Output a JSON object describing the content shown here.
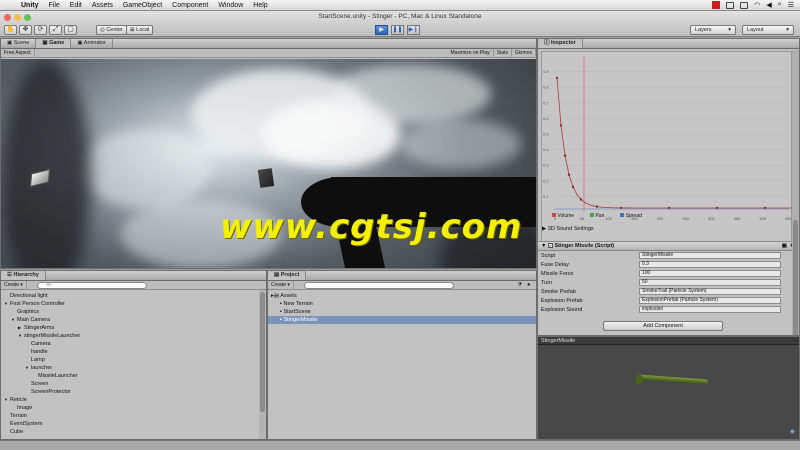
{
  "menubar": {
    "apple": "",
    "items": [
      "Unity",
      "File",
      "Edit",
      "Assets",
      "GameObject",
      "Component",
      "Window",
      "Help"
    ]
  },
  "window": {
    "title": "StartScene.unity - Stinger - PC, Mac & Linux Standalone"
  },
  "toolbar": {
    "pivot_label": "Center",
    "space_label": "Local",
    "layers_label": "Layers",
    "layout_label": "Layout"
  },
  "scene_tabs": [
    "Scene",
    "Game",
    "Animator"
  ],
  "game_bar": {
    "aspect": "Free Aspect",
    "maximize": "Maximize on Play",
    "stats": "Stats",
    "gizmos": "Gizmos"
  },
  "hierarchy": {
    "title": "Hierarchy",
    "create": "Create",
    "search_placeholder": "All",
    "items": [
      {
        "label": "Directional light",
        "indent": 0,
        "arrow": ""
      },
      {
        "label": "First Person Controller",
        "indent": 0,
        "arrow": "▼"
      },
      {
        "label": "Graphics",
        "indent": 1,
        "arrow": ""
      },
      {
        "label": "Main Camera",
        "indent": 1,
        "arrow": "▼"
      },
      {
        "label": "StingerArms",
        "indent": 2,
        "arrow": "▶"
      },
      {
        "label": "stingerMissileLauncher",
        "indent": 2,
        "arrow": "▼"
      },
      {
        "label": "Camera",
        "indent": 3,
        "arrow": ""
      },
      {
        "label": "handle",
        "indent": 3,
        "arrow": ""
      },
      {
        "label": "Lamp",
        "indent": 3,
        "arrow": ""
      },
      {
        "label": "launcher",
        "indent": 3,
        "arrow": "▼"
      },
      {
        "label": "MissileLauncher",
        "indent": 4,
        "arrow": ""
      },
      {
        "label": "Screen",
        "indent": 3,
        "arrow": ""
      },
      {
        "label": "ScreenProtector",
        "indent": 3,
        "arrow": ""
      },
      {
        "label": "Reticle",
        "indent": 0,
        "arrow": "▼"
      },
      {
        "label": "Image",
        "indent": 1,
        "arrow": ""
      },
      {
        "label": "Terrain",
        "indent": 0,
        "arrow": ""
      },
      {
        "label": "EventSystem",
        "indent": 0,
        "arrow": ""
      },
      {
        "label": "Cube",
        "indent": 0,
        "arrow": ""
      }
    ]
  },
  "project": {
    "title": "Project",
    "create": "Create",
    "items": [
      {
        "label": "Assets",
        "selected": false
      },
      {
        "label": "New Terrain",
        "selected": false
      },
      {
        "label": "StartScene",
        "selected": false
      },
      {
        "label": "StingerMissile",
        "selected": true
      }
    ]
  },
  "inspector": {
    "title": "Inspector",
    "curve_y_ticks": [
      "0.9",
      "0.8",
      "0.7",
      "0.6",
      "0.5",
      "0.4",
      "0.3",
      "0.2",
      "0.1"
    ],
    "curve_x_ticks": [
      "0",
      "50",
      "100",
      "150",
      "200",
      "250",
      "300",
      "350",
      "400",
      "450"
    ],
    "curve_tabs": [
      "Volume",
      "Pan",
      "Spread"
    ],
    "settings_label": "3D Sound Settings",
    "component_title": "Stinger Missile (Script)",
    "fields": [
      {
        "label": "Script",
        "value": "StingerMissile"
      },
      {
        "label": "Fuse Delay",
        "value": "0.3"
      },
      {
        "label": "Missile Force",
        "value": "100"
      },
      {
        "label": "Turn",
        "value": "50"
      },
      {
        "label": "Smoke Prefab",
        "value": "SmokeTrail (Particle System)"
      },
      {
        "label": "Explosion Prefab",
        "value": "ExplosionPrefab (Particle System)"
      },
      {
        "label": "Explosion Sound",
        "value": "explosion"
      }
    ],
    "add_component": "Add Component"
  },
  "preview": {
    "title": "StingerMissile"
  },
  "watermark": "www.cgtsj.com",
  "colors": {
    "selection": "#7b95b8",
    "play_blue": "#3c72c8",
    "curve_red": "#e05050",
    "missile_green": "#5c7a2e"
  }
}
